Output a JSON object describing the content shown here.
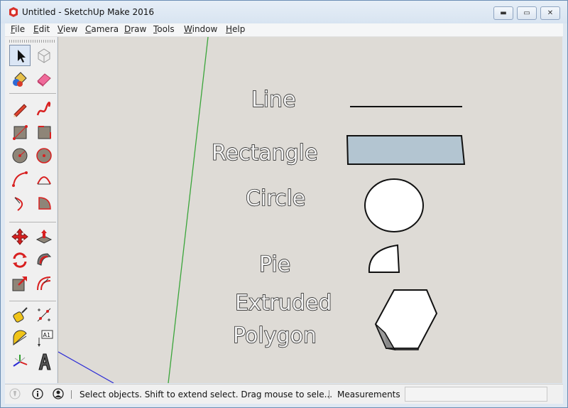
{
  "window": {
    "title": "Untitled - SketchUp Make 2016",
    "minimize": "▬",
    "maximize": "▭",
    "close": "✕"
  },
  "menu": [
    "File",
    "Edit",
    "View",
    "Camera",
    "Draw",
    "Tools",
    "Window",
    "Help"
  ],
  "menu_access": [
    "F",
    "E",
    "V",
    "C",
    "D",
    "T",
    "W",
    "H"
  ],
  "menu_rest": [
    "ile",
    "dit",
    "iew",
    "amera",
    "raw",
    "ools",
    "indow",
    "elp"
  ],
  "toolbar": {
    "tools": [
      "select-tool",
      "component-tool",
      "paint-bucket-tool",
      "eraser-tool",
      "line-tool",
      "freehand-tool",
      "rectangle-tool",
      "rotated-rectangle-tool",
      "circle-tool",
      "polygon-tool",
      "arc-tool",
      "two-point-arc-tool",
      "three-point-arc-tool",
      "pie-tool",
      "move-tool",
      "push-pull-tool",
      "rotate-tool",
      "follow-me-tool",
      "scale-tool",
      "offset-tool",
      "tape-measure-tool",
      "dimension-tool",
      "protractor-tool",
      "text-tool",
      "axes-tool",
      "3d-text-tool"
    ],
    "text_tool_glyph": "A1"
  },
  "canvas": {
    "labels": {
      "line": "Line",
      "rectangle": "Rectangle",
      "circle": "Circle",
      "pie": "Pie",
      "extruded": "Extruded",
      "polygon": "Polygon"
    },
    "colors": {
      "background": "#dedbd6",
      "green_axis": "#3aa53a",
      "blue_axis": "#2b2bd6",
      "rectangle_fill": "#b3c5d1"
    }
  },
  "status": {
    "hint": "Select objects. Shift to extend select. Drag mouse to sele...",
    "measurements_label": "Measurements",
    "measurements_value": ""
  }
}
